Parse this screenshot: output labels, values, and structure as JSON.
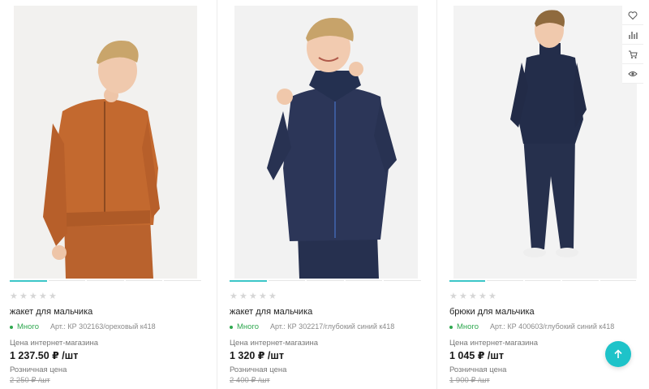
{
  "colors": {
    "accent": "#1ec3c9",
    "in_stock": "#2fa84f",
    "star_empty": "#d6d6d6"
  },
  "side_actions": [
    "heart-icon",
    "compare-chart-icon",
    "cart-icon",
    "eye-icon"
  ],
  "scroll_top_icon": "arrow-up-icon",
  "products": [
    {
      "name": "жакет для мальчика",
      "stock": "Много",
      "article": "Арт.: КР 302163/ореховый к418",
      "price_label": "Цена интернет-магазина",
      "price": "1 237.50 ₽ /шт",
      "retail_label": "Розничная цена",
      "retail_price": "2 250 ₽ /шт",
      "rating": 0,
      "slides": 5,
      "active_slide": 1
    },
    {
      "name": "жакет для мальчика",
      "stock": "Много",
      "article": "Арт.: КР 302217/глубокий синий к418",
      "price_label": "Цена интернет-магазина",
      "price": "1 320 ₽ /шт",
      "retail_label": "Розничная цена",
      "retail_price": "2 400 ₽ /шт",
      "rating": 0,
      "slides": 5,
      "active_slide": 1
    },
    {
      "name": "брюки для мальчика",
      "stock": "Много",
      "article": "Арт.: КР 400603/глубокий синий к418",
      "price_label": "Цена интернет-магазина",
      "price": "1 045 ₽ /шт",
      "retail_label": "Розничная цена",
      "retail_price": "1 900 ₽ /шт",
      "rating": 0,
      "slides": 5,
      "active_slide": 1
    }
  ]
}
